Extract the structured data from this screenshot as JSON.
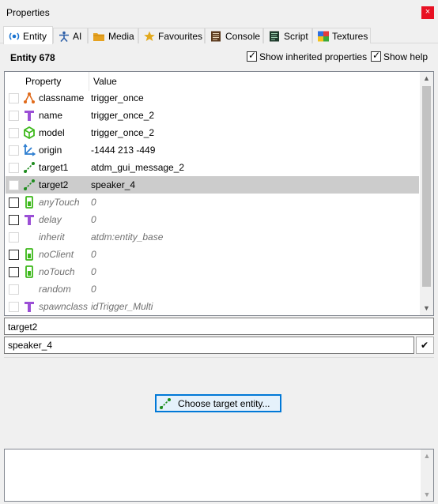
{
  "window": {
    "title": "Properties",
    "close_glyph": "×"
  },
  "tabs": [
    {
      "label": "Entity",
      "icon": "entity-icon",
      "active": true
    },
    {
      "label": "AI",
      "icon": "ai-icon"
    },
    {
      "label": "Media",
      "icon": "folder-icon"
    },
    {
      "label": "Favourites",
      "icon": "star-icon"
    },
    {
      "label": "Console",
      "icon": "console-icon"
    },
    {
      "label": "Script",
      "icon": "script-icon"
    },
    {
      "label": "Textures",
      "icon": "textures-icon"
    }
  ],
  "header": {
    "entity_title": "Entity 678",
    "show_inherited": {
      "label": "Show inherited properties",
      "checked": true
    },
    "show_help": {
      "label": "Show help",
      "checked": true
    }
  },
  "grid": {
    "columns": [
      "Property",
      "Value"
    ],
    "rows": [
      {
        "property": "classname",
        "value": "trigger_once",
        "icon": "classname-icon",
        "inherited": false,
        "selected": false,
        "dark_check": false
      },
      {
        "property": "name",
        "value": "trigger_once_2",
        "icon": "text-t-icon",
        "inherited": false,
        "selected": false,
        "dark_check": false
      },
      {
        "property": "model",
        "value": "trigger_once_2",
        "icon": "model-cube-icon",
        "inherited": false,
        "selected": false,
        "dark_check": false
      },
      {
        "property": "origin",
        "value": "-1444 213 -449",
        "icon": "origin-axes-icon",
        "inherited": false,
        "selected": false,
        "dark_check": false
      },
      {
        "property": "target1",
        "value": "atdm_gui_message_2",
        "icon": "target-link-icon",
        "inherited": false,
        "selected": false,
        "dark_check": false
      },
      {
        "property": "target2",
        "value": "speaker_4",
        "icon": "target-link-icon",
        "inherited": false,
        "selected": true,
        "dark_check": false
      },
      {
        "property": "anyTouch",
        "value": "0",
        "icon": "bool-icon",
        "inherited": true,
        "selected": false,
        "dark_check": true
      },
      {
        "property": "delay",
        "value": "0",
        "icon": "text-t-icon",
        "inherited": true,
        "selected": false,
        "dark_check": true
      },
      {
        "property": "inherit",
        "value": "atdm:entity_base",
        "icon": "none",
        "inherited": true,
        "selected": false,
        "dark_check": false
      },
      {
        "property": "noClient",
        "value": "0",
        "icon": "bool-icon",
        "inherited": true,
        "selected": false,
        "dark_check": true
      },
      {
        "property": "noTouch",
        "value": "0",
        "icon": "bool-icon",
        "inherited": true,
        "selected": false,
        "dark_check": true
      },
      {
        "property": "random",
        "value": "0",
        "icon": "none",
        "inherited": true,
        "selected": false,
        "dark_check": false
      },
      {
        "property": "spawnclass",
        "value": "idTrigger_Multi",
        "icon": "text-t-icon",
        "inherited": true,
        "selected": false,
        "dark_check": false
      }
    ]
  },
  "editor": {
    "key": "target2",
    "value": "speaker_4",
    "apply_glyph": "✔",
    "choose_button_label": "Choose target entity..."
  },
  "colors": {
    "selection": "#cccccc",
    "accent": "#0078d7",
    "link_green": "#1e8c1e",
    "text_purple": "#9b4fd6",
    "bool_green": "#3cb81a",
    "classname_orange": "#e06a1a",
    "origin_blue": "#2f7fd1"
  }
}
